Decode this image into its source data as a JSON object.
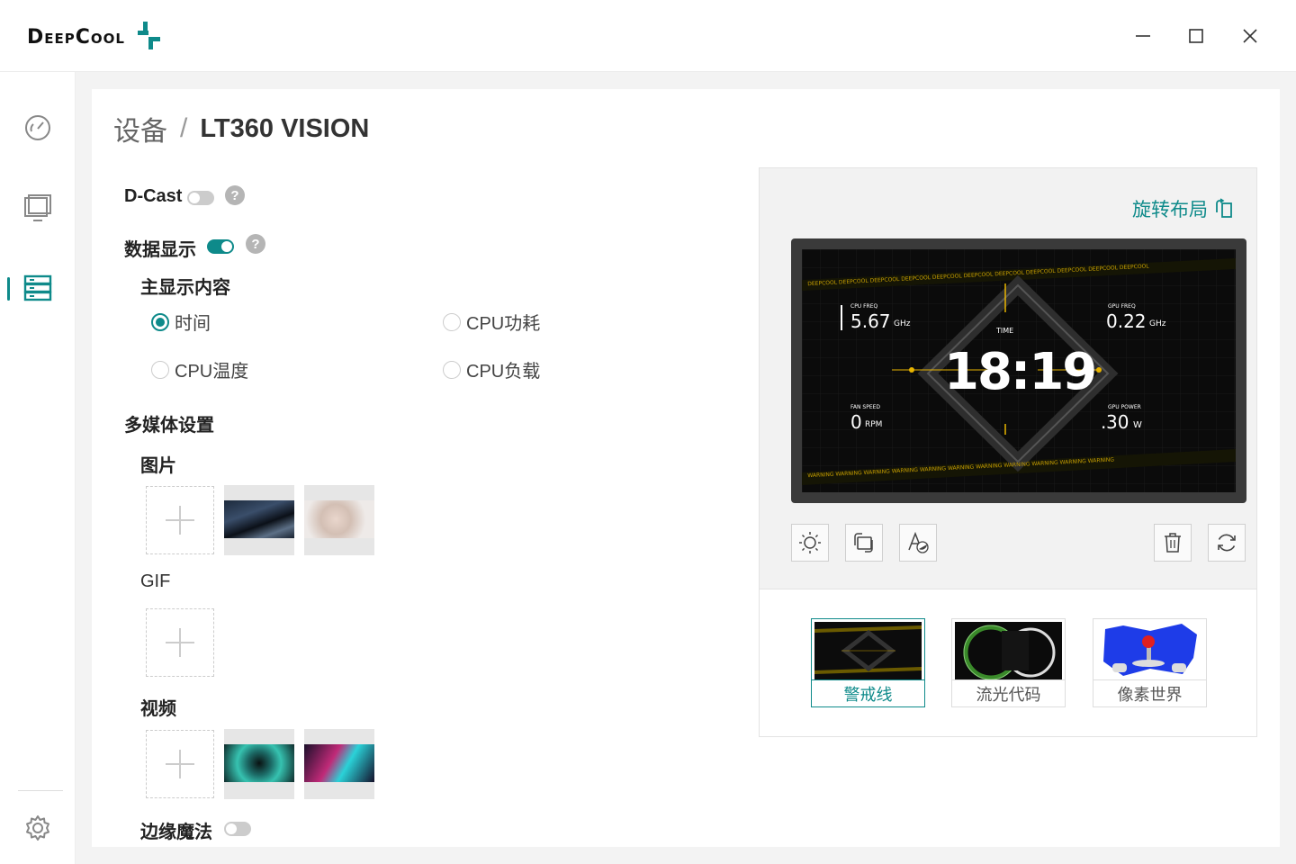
{
  "app": {
    "logo_text": "DeepCool"
  },
  "window": {
    "minimize": "—",
    "maximize": "☐",
    "close": "✕"
  },
  "breadcrumb": {
    "parent": "设备",
    "separator": "/",
    "current": "LT360 VISION"
  },
  "dcast": {
    "label": "D-Cast",
    "enabled": false,
    "help": "?"
  },
  "data_display": {
    "label": "数据显示",
    "enabled": true,
    "help": "?"
  },
  "main_content": {
    "label": "主显示内容",
    "options": [
      "时间",
      "CPU功耗",
      "CPU温度",
      "CPU负载"
    ],
    "selected": "时间"
  },
  "media": {
    "label": "多媒体设置",
    "images_label": "图片",
    "gif_label": "GIF",
    "video_label": "视频"
  },
  "edge_magic": {
    "label": "边缘魔法",
    "enabled": false
  },
  "preview": {
    "rotate_label": "旋转布局",
    "lcd": {
      "banner_text": "DEEPCOOL DEEPCOOL DEEPCOOL DEEPCOOL DEEPCOOL DEEPCOOL DEEPCOOL DEEPCOOL DEEPCOOL DEEPCOOL DEEPCOOL",
      "warning_text": "WARNING WARNING WARNING WARNING WARNING WARNING WARNING WARNING WARNING WARNING WARNING",
      "cpu_freq_label": "CPU FREQ",
      "cpu_freq_value": "5.67",
      "cpu_freq_unit": "GHz",
      "gpu_freq_label": "GPU FREQ",
      "gpu_freq_value": "0.22",
      "gpu_freq_unit": "GHz",
      "time_label": "TIME",
      "time_value": "18:19",
      "fan_label": "FAN SPEED",
      "fan_value": "0",
      "fan_unit": "RPM",
      "gpu_power_label": "GPU POWER",
      "gpu_power_value": "30",
      "gpu_power_unit": "W"
    },
    "themes": [
      "警戒线",
      "流光代码",
      "像素世界"
    ],
    "selected_theme": "警戒线"
  },
  "colors": {
    "accent": "#0e8a8a",
    "lcd_accent": "#e8b400"
  }
}
